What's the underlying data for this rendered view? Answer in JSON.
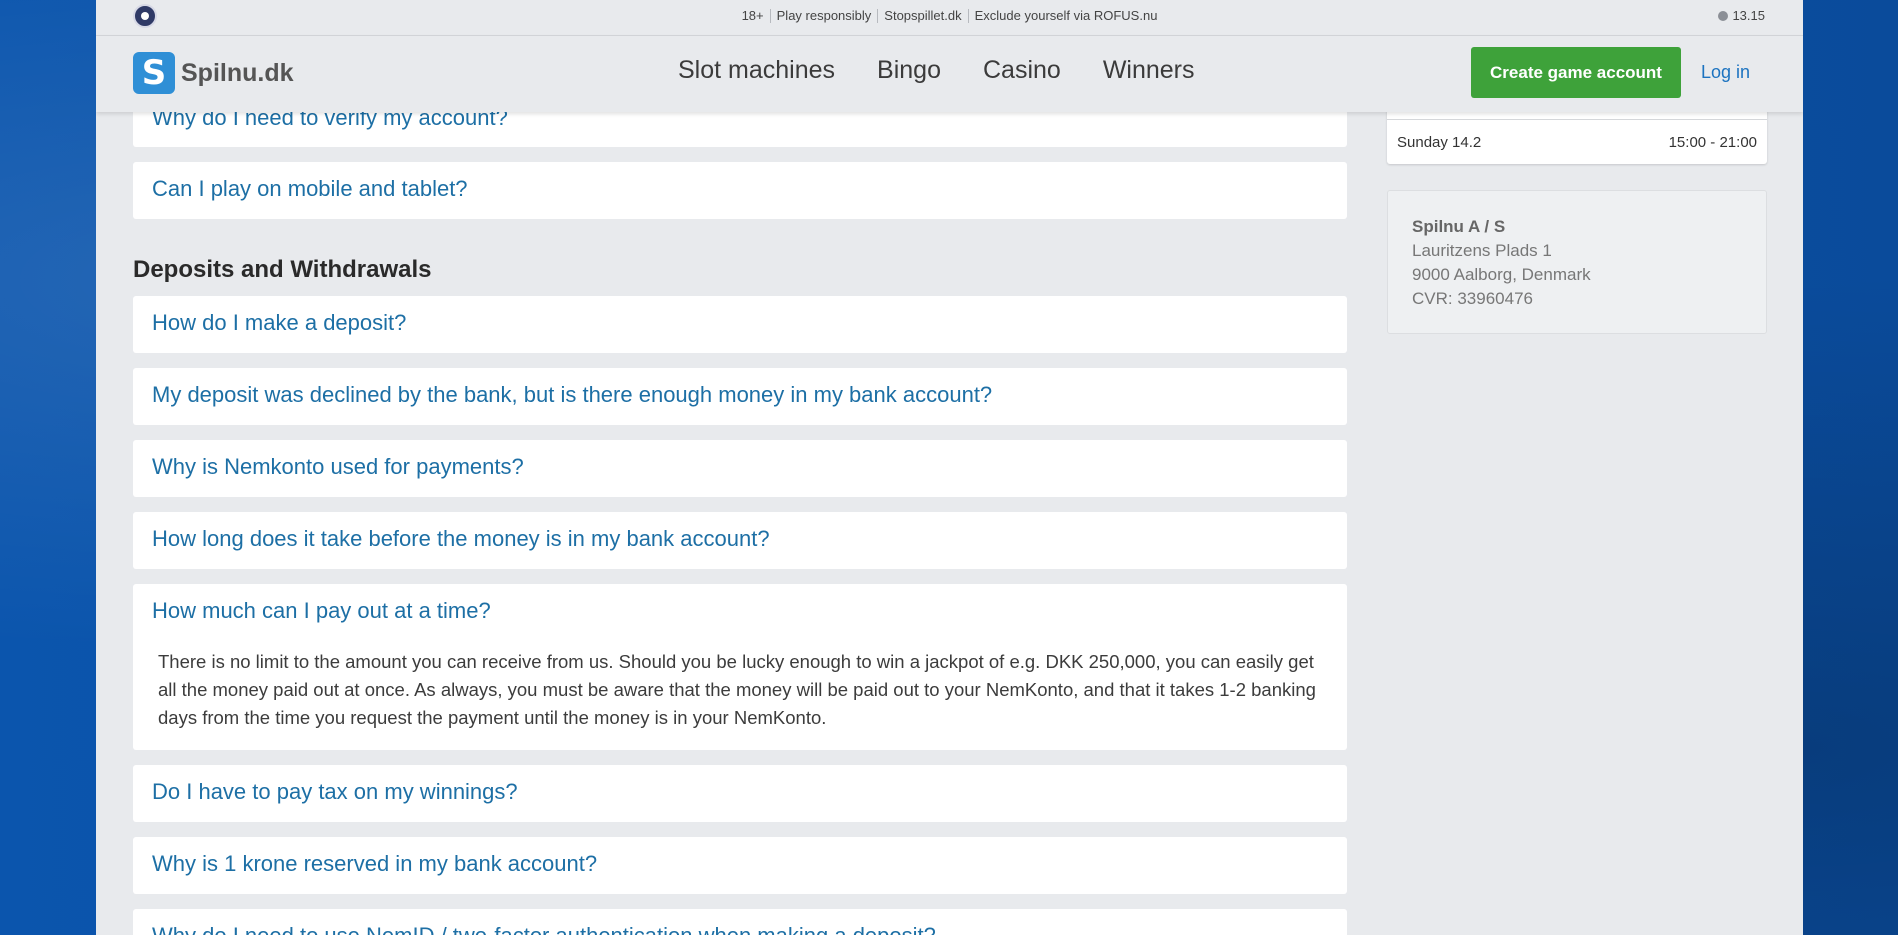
{
  "topbar": {
    "links": [
      "18+",
      "Play responsibly",
      "Stopspillet.dk",
      "Exclude yourself via ROFUS.nu"
    ],
    "time": "13.15"
  },
  "header": {
    "logo_text": "Spilnu.dk",
    "nav": [
      "Slot machines",
      "Bingo",
      "Casino",
      "Winners"
    ],
    "create_account": "Create game account",
    "login": "Log in"
  },
  "faq": {
    "top_items": [
      "Why do I need to verify my account?",
      "Can I play on mobile and tablet?"
    ],
    "section_title": "Deposits and Withdrawals",
    "items": [
      "How do I make a deposit?",
      "My deposit was declined by the bank, but is there enough money in my bank account?",
      "Why is Nemkonto used for payments?",
      "How long does it take before the money is in my bank account?"
    ],
    "expanded": {
      "question": "How much can I pay out at a time?",
      "answer": "There is no limit to the amount you can receive from us. Should you be lucky enough to win a jackpot of e.g. DKK 250,000, you can easily get all the money paid out at once. As always, you must be aware that the money will be paid out to your NemKonto, and that it takes 1-2 banking days from the time you request the payment until the money is in your NemKonto."
    },
    "after_items": [
      "Do I have to pay tax on my winnings?",
      "Why is 1 krone reserved in my bank account?",
      "Why do I need to use NemID / two-factor authentication when making a deposit?"
    ]
  },
  "sidebar": {
    "hours": {
      "day": "Sunday 14.2",
      "time": "15:00 - 21:00"
    },
    "address": {
      "name": "Spilnu A / S",
      "street": "Lauritzens Plads 1",
      "city": "9000 Aalborg, Denmark",
      "cvr": "CVR: 33960476"
    }
  }
}
